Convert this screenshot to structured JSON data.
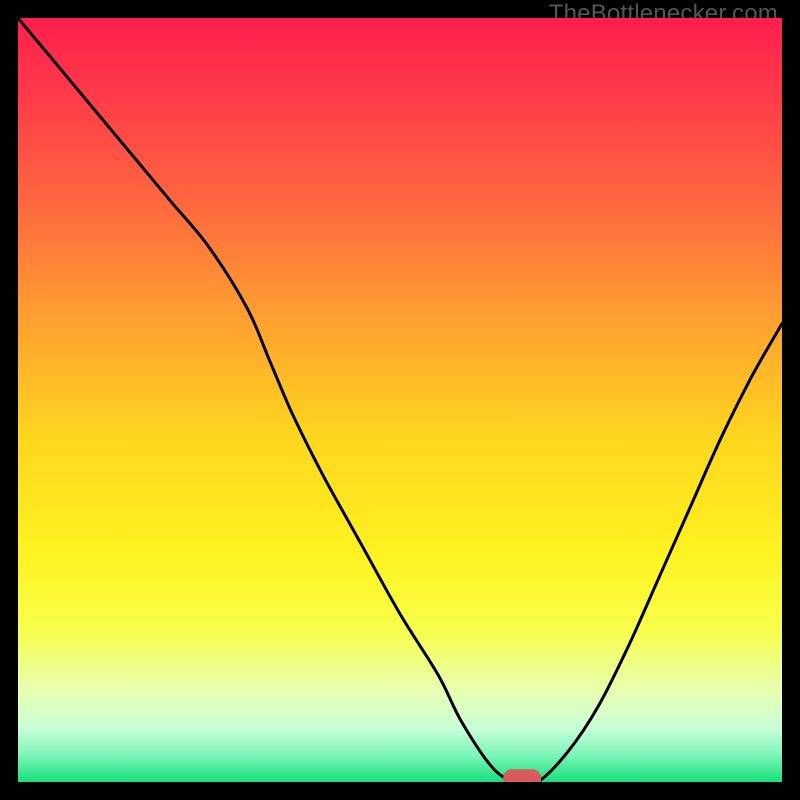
{
  "watermark": "TheBottleneсker.com",
  "chart_data": {
    "type": "line",
    "title": "",
    "xlabel": "",
    "ylabel": "",
    "xlim": [
      0,
      100
    ],
    "ylim": [
      0,
      100
    ],
    "series": [
      {
        "name": "curve",
        "x": [
          0,
          5,
          10,
          15,
          20,
          25,
          30,
          33,
          36,
          40,
          45,
          50,
          55,
          58,
          62,
          65,
          68,
          72,
          76,
          80,
          84,
          88,
          92,
          96,
          100
        ],
        "values": [
          100,
          94,
          88,
          82,
          76,
          70,
          62,
          55,
          48,
          40,
          31,
          22,
          14,
          8,
          2,
          0,
          0,
          4,
          10,
          18,
          27,
          36,
          45,
          53,
          60
        ]
      }
    ],
    "marker": {
      "x": 66,
      "y": 0,
      "w": 5,
      "h": 2.4,
      "color": "#d85a5a"
    },
    "gradient_stops": [
      {
        "offset": 0.0,
        "color": "#ff1f4b"
      },
      {
        "offset": 0.1,
        "color": "#ff3a4a"
      },
      {
        "offset": 0.25,
        "color": "#ff6a3f"
      },
      {
        "offset": 0.4,
        "color": "#ffa22f"
      },
      {
        "offset": 0.55,
        "color": "#ffd61f"
      },
      {
        "offset": 0.7,
        "color": "#fff221"
      },
      {
        "offset": 0.8,
        "color": "#f7ff4a"
      },
      {
        "offset": 0.88,
        "color": "#e8ffb0"
      },
      {
        "offset": 0.93,
        "color": "#c8ffd8"
      },
      {
        "offset": 0.965,
        "color": "#7cf5b8"
      },
      {
        "offset": 1.0,
        "color": "#18e07a"
      }
    ]
  }
}
